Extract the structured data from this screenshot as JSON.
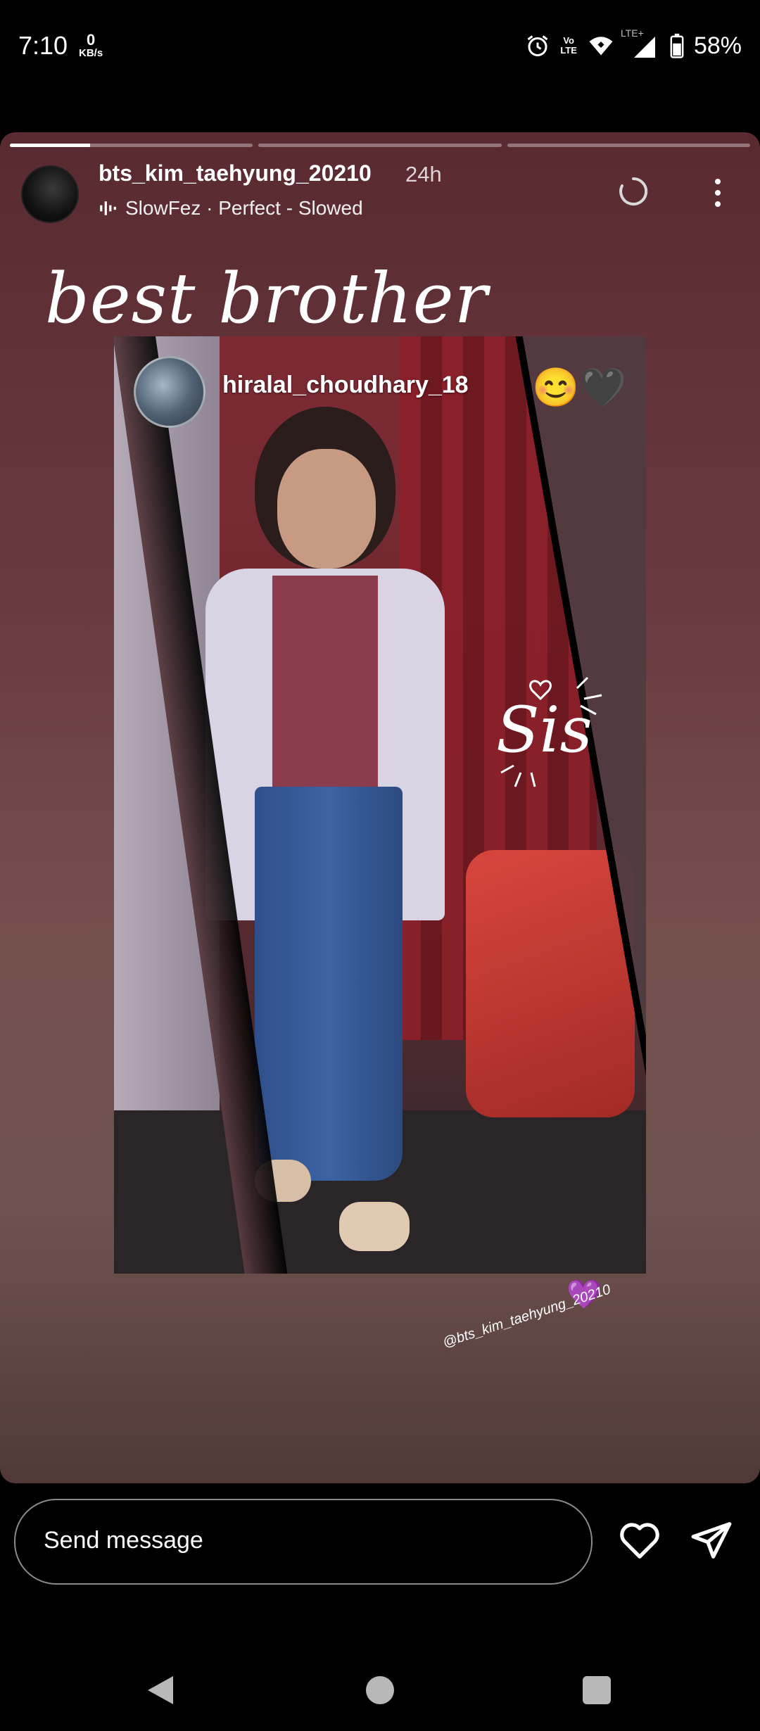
{
  "status_bar": {
    "time": "7:10",
    "speed_value": "0",
    "speed_unit": "KB/s",
    "volte_top": "Vo",
    "volte_bottom": "LTE",
    "lte_label": "LTE+",
    "battery": "58%",
    "icons": [
      "alarm-icon",
      "volte-icon",
      "wifi-icon",
      "signal-icon",
      "battery-icon"
    ]
  },
  "story": {
    "progress_segments": [
      {
        "fill": 0.33
      },
      {
        "fill": 0
      },
      {
        "fill": 0
      }
    ],
    "username": "bts_kim_taehyung_20210",
    "time_ago": "24h",
    "music": "SlowFez · Perfect - Slowed",
    "script_title": "best brother",
    "tag_name": "hiralal_choudhary_18",
    "emoji": "😊🖤",
    "sis_text": "Sis",
    "watermark": "@bts_kim_taehyung_20210",
    "heart_emoji": "💜"
  },
  "reply": {
    "placeholder": "Send message"
  },
  "colors": {
    "story_bg_top": "#5a2a31",
    "story_bg_bottom": "#503937",
    "accent_purple": "#8b3fe0"
  }
}
